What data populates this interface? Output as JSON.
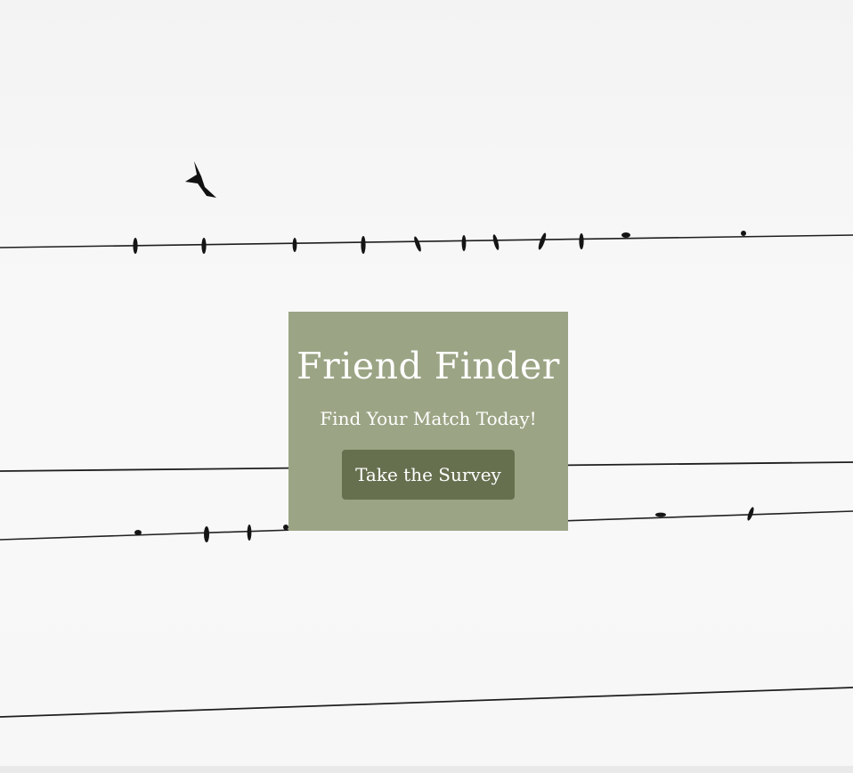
{
  "hero": {
    "title": "Friend Finder",
    "tagline": "Find Your Match Today!",
    "cta_label": "Take the Survey"
  },
  "colors": {
    "card_background": "#9ba484",
    "button_background": "#66704f",
    "text": "#ffffff",
    "wire": "#1a1a1a"
  },
  "background_image": {
    "subject": "birds perched on power lines",
    "icon": "bird-silhouette"
  }
}
